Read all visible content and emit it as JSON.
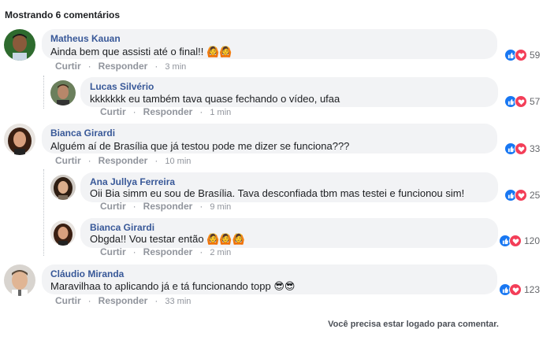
{
  "header": {
    "title": "Mostrando 6 comentários"
  },
  "actions": {
    "like": "Curtir",
    "reply": "Responder"
  },
  "comments": [
    {
      "author": "Matheus Kauan",
      "text": "Ainda bem que assisti até o final!!",
      "emoji": "🙆🙆",
      "time": "3 min",
      "reactions": "59"
    },
    {
      "author": "Lucas Silvério",
      "text": "kkkkkkk eu também tava quase fechando o vídeo, ufaa",
      "emoji": "",
      "time": "1 min",
      "reactions": "57"
    },
    {
      "author": "Bianca Girardi",
      "text": "Alguém aí de Brasília que já testou pode me dizer se funciona???",
      "emoji": "",
      "time": "10 min",
      "reactions": "33"
    },
    {
      "author": "Ana Jullya Ferreira",
      "text": "Oii Bia simm eu sou de Brasília. Tava desconfiada tbm mas testei e funcionou sim!",
      "emoji": "",
      "time": "9 min",
      "reactions": "25"
    },
    {
      "author": "Bianca Girardi",
      "text": "Obgda!! Vou testar então",
      "emoji": "🙆🙆🙆",
      "time": "2 min",
      "reactions": "120"
    },
    {
      "author": "Cláudio Miranda",
      "text": "Maravilhaa to aplicando já e tá funcionando topp",
      "emoji": "😎😎",
      "time": "33 min",
      "reactions": "123"
    }
  ],
  "footer": {
    "text": "Você precisa estar logado para comentar."
  },
  "colors": {
    "name": "#385898",
    "like": "#1877f2",
    "love": "#f33e58",
    "bubble": "#f2f3f5"
  }
}
